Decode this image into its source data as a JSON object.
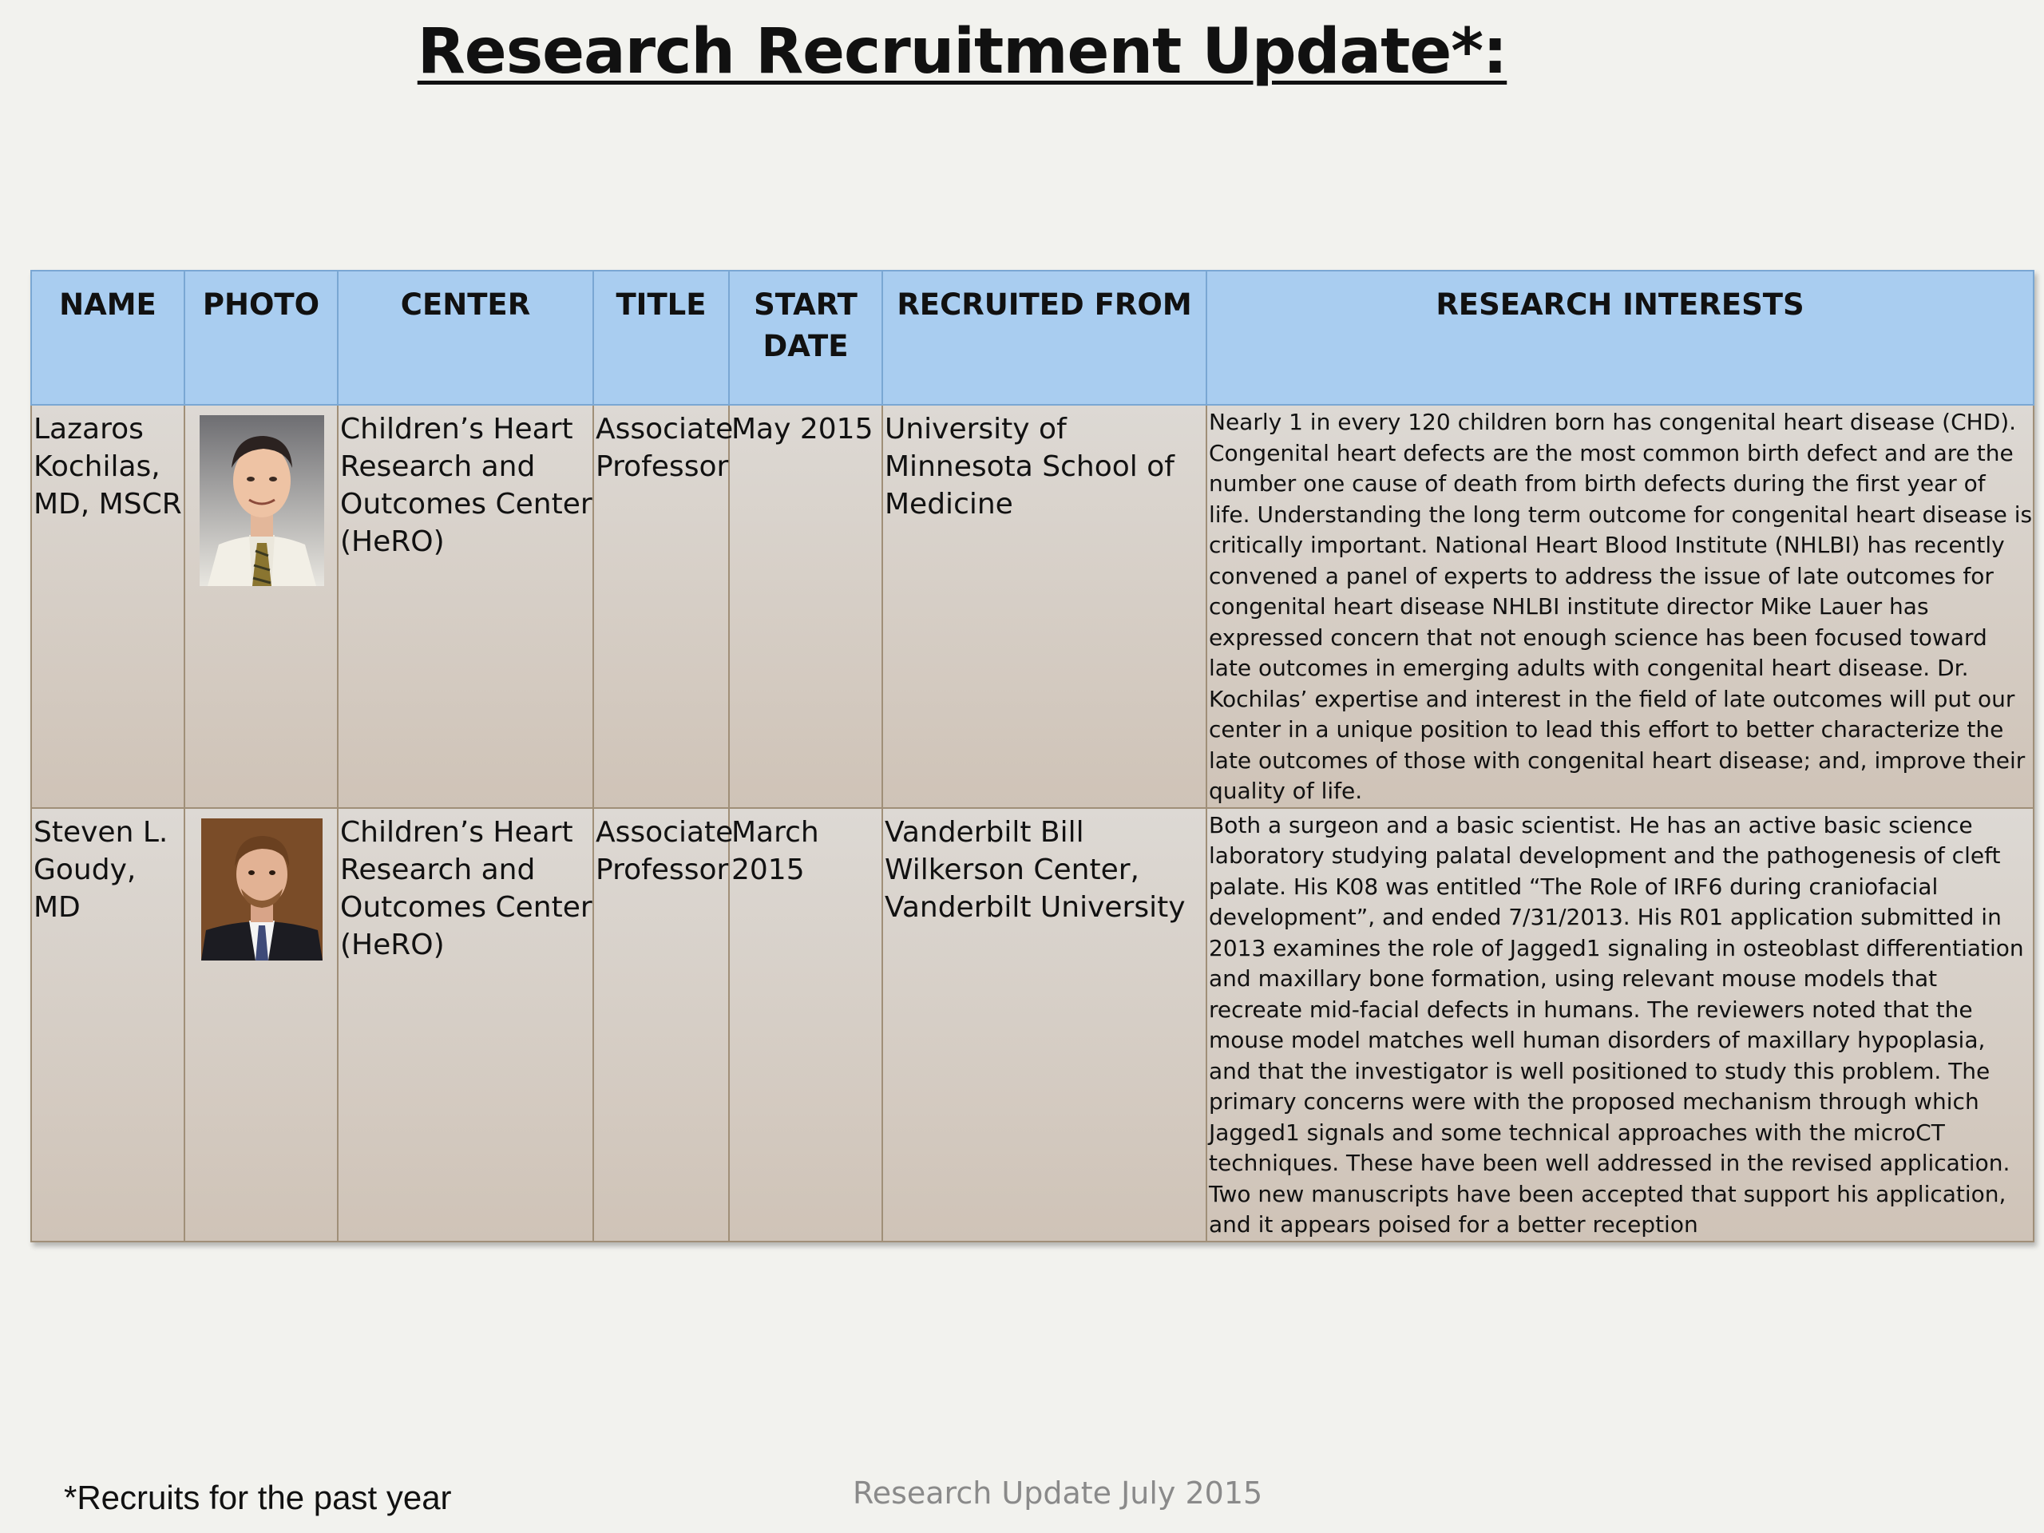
{
  "title": "Research Recruitment Update*:",
  "table": {
    "headers": {
      "name": "NAME",
      "photo": "PHOTO",
      "center": "CENTER",
      "title": "TITLE",
      "start_date": "START DATE",
      "recruited_from": "RECRUITED FROM",
      "research_interests": "RESEARCH INTERESTS"
    },
    "rows": [
      {
        "name": "Lazaros Kochilas, MD, MSCR",
        "photo_icon": "portrait-photo",
        "center": "Children’s Heart Research and Outcomes Center (HeRO)",
        "title": "Associate Professor",
        "start_date": "May 2015",
        "recruited_from": "University of Minnesota School of Medicine",
        "research_interests": "Nearly 1 in every 120 children born has congenital heart disease (CHD). Congenital heart defects are the most common birth defect and are the number one cause of death from birth defects during the first year of life. Understanding the long term outcome for congenital heart disease is critically important. National Heart Blood Institute (NHLBI) has recently convened a panel of experts to address the issue of late outcomes for congenital heart disease NHLBI institute director Mike Lauer has expressed concern that not enough science has been focused toward late outcomes in emerging adults with congenital heart disease. Dr. Kochilas’ expertise and interest in the field of late outcomes will put our center in a unique position to lead this effort to better characterize the late outcomes of those with congenital heart disease; and, improve their quality of life."
      },
      {
        "name": "Steven L. Goudy, MD",
        "photo_icon": "portrait-photo",
        "center": "Children’s Heart Research and Outcomes Center (HeRO)",
        "title": "Associate Professor",
        "start_date": "March 2015",
        "recruited_from": "Vanderbilt Bill Wilkerson Center, Vanderbilt University",
        "research_interests": "Both a surgeon and a basic scientist. He has an active basic science laboratory studying palatal development and the pathogenesis of cleft palate. His K08 was entitled “The Role of IRF6 during craniofacial development”, and ended 7/31/2013. His R01 application submitted in 2013 examines the role of Jagged1 signaling in osteoblast differentiation and maxillary bone formation, using relevant mouse models that recreate mid-facial defects in humans. The reviewers noted that the mouse model matches well human disorders of maxillary hypoplasia, and that the investigator is well positioned to study this problem. The primary concerns were with the proposed mechanism through which Jagged1 signals and some technical approaches with the microCT techniques. These have been well addressed in the revised application. Two new manuscripts have been accepted that support his application, and it appears poised for a better reception"
      }
    ]
  },
  "footnote": "*Recruits for the past year",
  "footer": "Research Update July 2015"
}
